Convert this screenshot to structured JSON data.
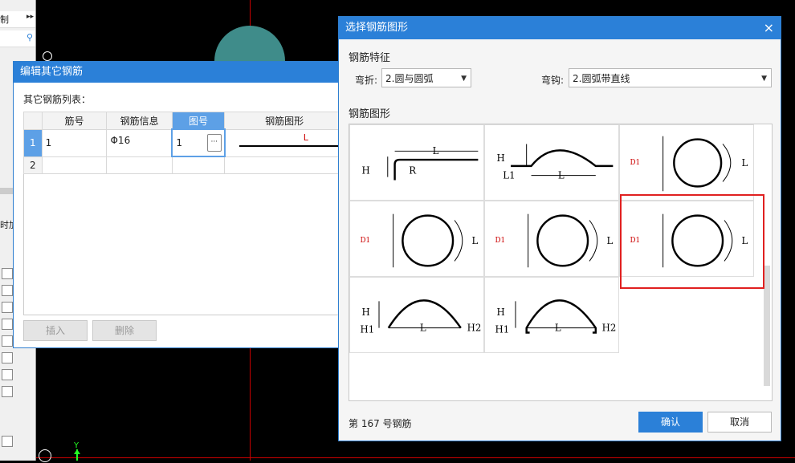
{
  "left_panel": {
    "label_top": "制",
    "label_mid": "时加"
  },
  "canvas": {
    "axis_y": "Y"
  },
  "edit_dialog": {
    "title": "编辑其它钢筋",
    "list_label": "其它钢筋列表：",
    "columns": [
      "筋号",
      "钢筋信息",
      "图号",
      "钢筋图形"
    ],
    "rows": [
      {
        "index": "1",
        "bar_no": "1",
        "info": "Φ16",
        "figure_no": "1",
        "shape_label": "L"
      },
      {
        "index": "2",
        "bar_no": "",
        "info": "",
        "figure_no": "",
        "shape_label": ""
      }
    ],
    "ellipsis": "···",
    "insert_label": "插入",
    "delete_label": "删除"
  },
  "shape_dialog": {
    "title": "选择钢筋图形",
    "close": "×",
    "section_feature": "钢筋特征",
    "bend_label": "弯折:",
    "bend_value": "2.圆与圆弧",
    "hook_label": "弯钩:",
    "hook_value": "2.圆弧带直线",
    "section_shape": "钢筋图形",
    "status": "第 167 号钢筋",
    "ok_label": "确认",
    "cancel_label": "取消",
    "labels": {
      "H": "H",
      "R": "R",
      "L": "L",
      "L1": "L1",
      "D1": "D1",
      "H1": "H1",
      "H2": "H2"
    }
  },
  "colors": {
    "accent": "#2b80d8",
    "highlight": "#e02020"
  }
}
